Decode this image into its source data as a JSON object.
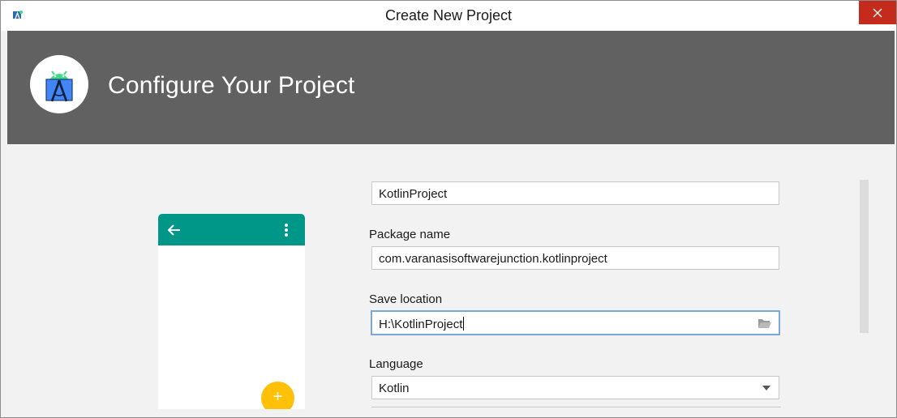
{
  "window": {
    "title": "Create New Project"
  },
  "header": {
    "title": "Configure Your Project",
    "logo_icon": "android-studio-logo-icon"
  },
  "preview": {
    "appbar_color": "#009688",
    "fab_color": "#ffc107",
    "fab_label": "+",
    "back_icon": "arrow-back-icon",
    "menu_icon": "more-vert-icon"
  },
  "form": {
    "name_value": "KotlinProject",
    "package_label": "Package name",
    "package_value": "com.varanasisoftwarejunction.kotlinproject",
    "save_location_label": "Save location",
    "save_location_value": "H:\\KotlinProject",
    "language_label": "Language",
    "language_value": "Kotlin"
  },
  "colors": {
    "header_band": "#616161",
    "close_button": "#c42b1c",
    "focus_border": "#7aa7de"
  }
}
